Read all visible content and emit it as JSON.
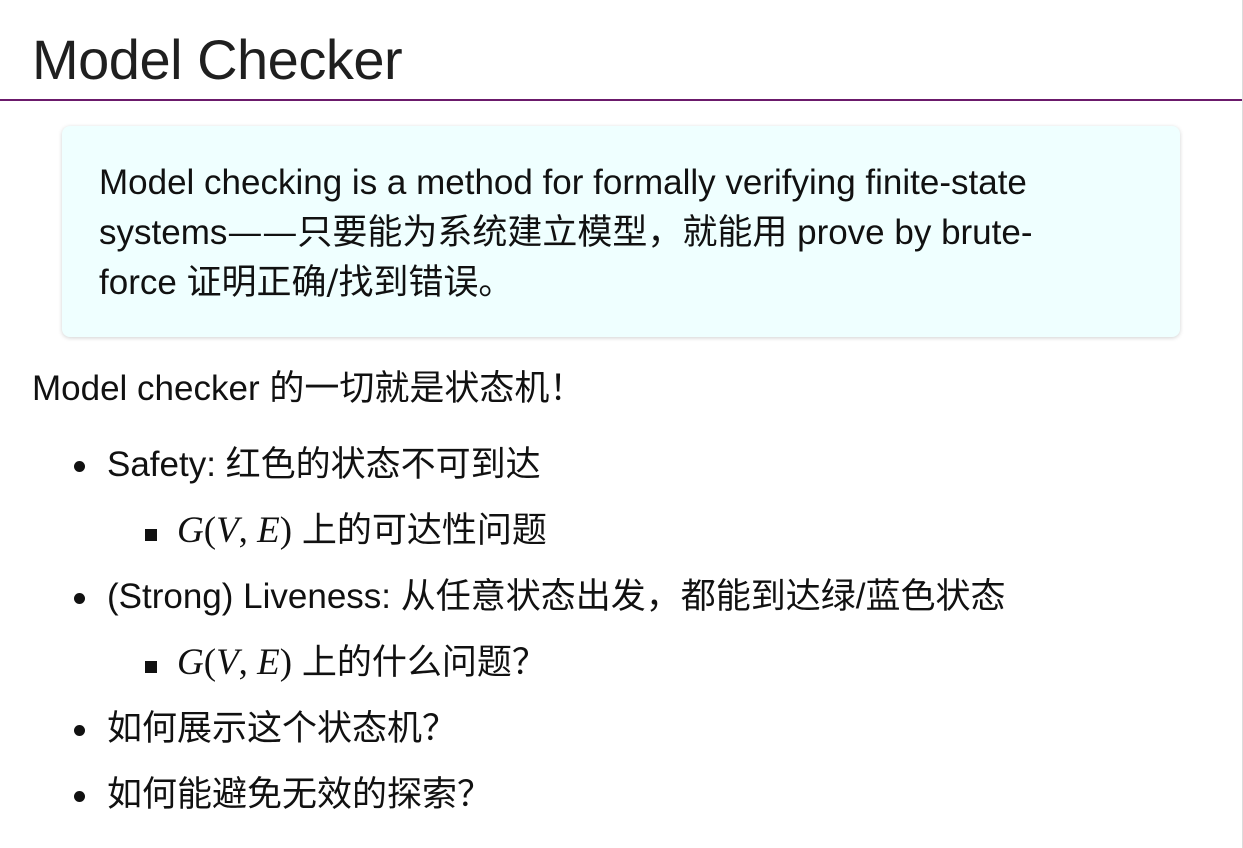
{
  "title": "Model Checker",
  "callout": {
    "line1": "Model checking is a method for formally verifying finite-state",
    "line2_en": "systems",
    "line2_cjk": "——只要能为系统建立模型，就能用",
    "line2_tail": " prove by brute-",
    "line3_en": "force ",
    "line3_cjk": "证明正确/找到错误。"
  },
  "lead": "Model checker 的一切就是状态机！",
  "list": {
    "item1": "Safety: 红色的状态不可到达",
    "item1_sub_math": {
      "G": "G",
      "open": "(",
      "V": "V",
      "comma": ", ",
      "E": "E",
      "close": ")"
    },
    "item1_sub_text": " 上的可达性问题",
    "item2": "(Strong) Liveness: 从任意状态出发，都能到达绿/蓝色状态",
    "item2_sub_text": " 上的什么问题？",
    "item3": "如何展示这个状态机？",
    "item4": "如何能避免无效的探索？"
  }
}
